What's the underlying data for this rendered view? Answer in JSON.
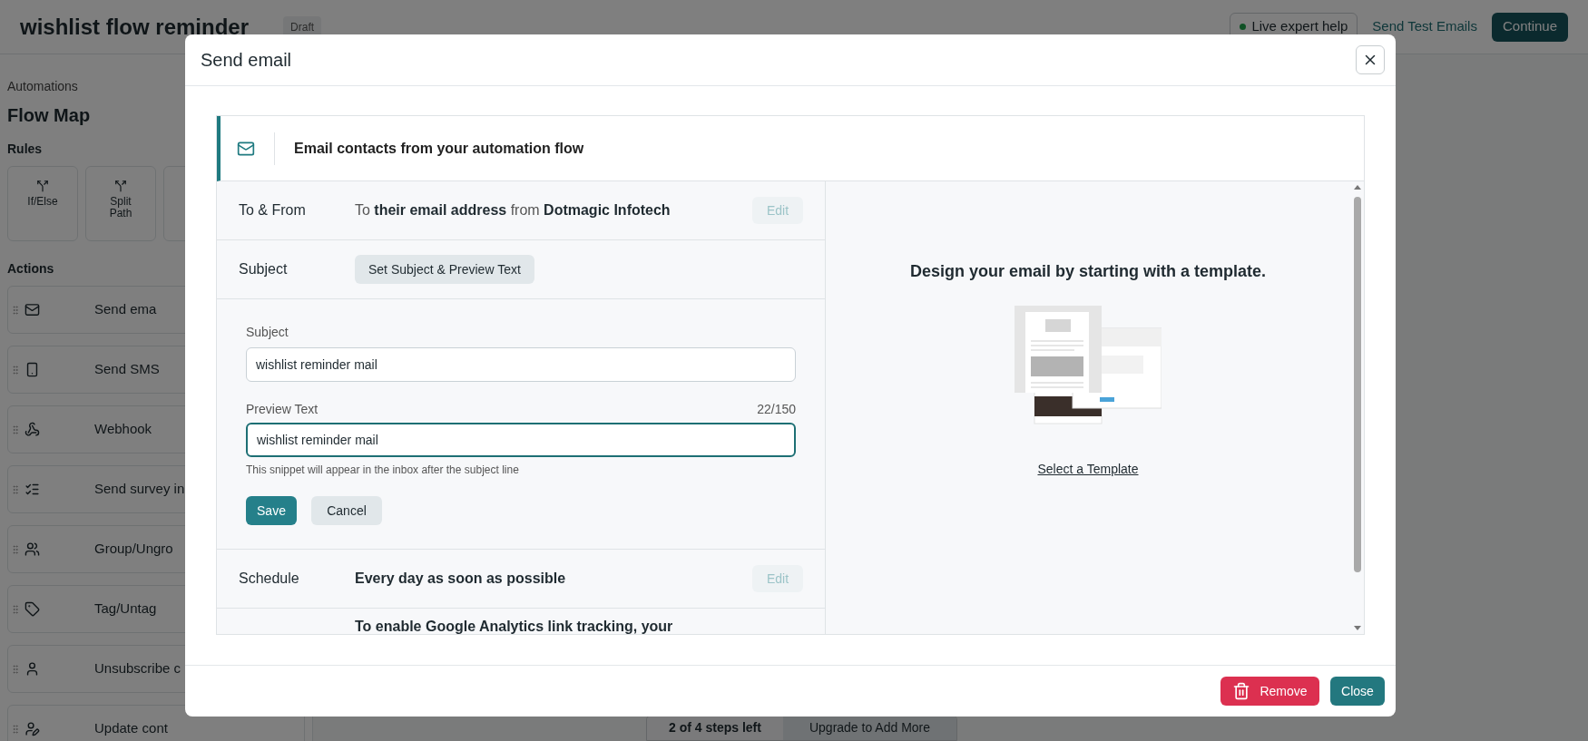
{
  "header": {
    "title": "wishlist flow reminder",
    "badge": "Draft",
    "help_button": "Live expert help",
    "test_link": "Send Test Emails",
    "continue_button": "Continue"
  },
  "sidebar": {
    "breadcrumb": "Automations",
    "title": "Flow Map",
    "rules_heading": "Rules",
    "rules": [
      {
        "label": "If/Else"
      },
      {
        "label": "Split Path"
      }
    ],
    "actions_heading": "Actions",
    "actions": [
      {
        "label": "Send ema"
      },
      {
        "label": "Send SMS"
      },
      {
        "label": "Webhook"
      },
      {
        "label": "Send survey in"
      },
      {
        "label": "Group/Ungro"
      },
      {
        "label": "Tag/Untag"
      },
      {
        "label": "Unsubscribe c"
      },
      {
        "label": "Update cont"
      }
    ]
  },
  "steps": {
    "count": "2 of 4 steps left",
    "upgrade": "Upgrade to Add More"
  },
  "modal": {
    "title": "Send email",
    "banner": "Email contacts from your automation flow",
    "to_from": {
      "label": "To & From",
      "text": "To **their email address** from **Dotmagic Infotech**",
      "edit": "Edit",
      "disabled": true
    },
    "subject": {
      "label": "Subject",
      "button": "Set Subject & Preview Text"
    },
    "form": {
      "subject_label": "Subject",
      "subject_value": "wishlist reminder mail",
      "preview_label": "Preview Text",
      "counter": "22/150",
      "preview_value": "wishlist reminder mail",
      "preview_focused": true,
      "hint": "This snippet will appear in the inbox after the subject line",
      "save": "Save",
      "cancel": "Cancel"
    },
    "schedule": {
      "label": "Schedule",
      "value": "Every day as soon as possible",
      "edit": "Edit",
      "disabled": true
    },
    "analytics": {
      "text": "To enable Google Analytics link tracking, your"
    },
    "template": {
      "heading": "Design your email by starting with a template.",
      "link": "Select a Template"
    },
    "footer": {
      "remove": "Remove",
      "close": "Close"
    }
  }
}
